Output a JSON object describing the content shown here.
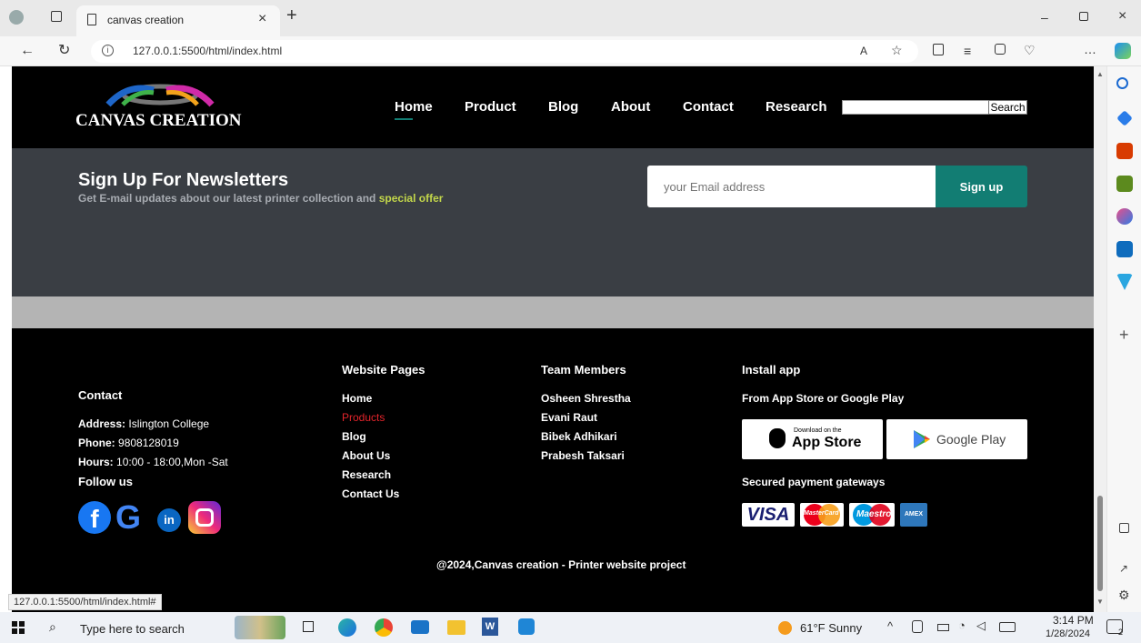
{
  "browser": {
    "tab_title": "canvas creation",
    "url": "127.0.0.1:5500/html/index.html",
    "status_url": "127.0.0.1:5500/html/index.html#"
  },
  "header": {
    "logo_text": "CANVAS CREATION",
    "nav": [
      "Home",
      "Product",
      "Blog",
      "About",
      "Contact",
      "Research"
    ],
    "active_nav": "Home",
    "search_button": "Search",
    "search_value": ""
  },
  "newsletter": {
    "title": "Sign Up For Newsletters",
    "subtitle": "Get E-mail updates about our latest printer collection and",
    "highlight": "special offer",
    "email_placeholder": "your Email address",
    "signup_label": "Sign up"
  },
  "footer": {
    "contact": {
      "heading": "Contact",
      "address_label": "Address:",
      "address": "Islington College",
      "phone_label": "Phone:",
      "phone": "9808128019",
      "hours_label": "Hours:",
      "hours": "10:00 - 18:00,Mon -Sat",
      "follow": "Follow us"
    },
    "pages": {
      "heading": "Website Pages",
      "items": [
        "Home",
        "Products",
        "Blog",
        "About Us",
        "Research",
        "Contact Us"
      ]
    },
    "team": {
      "heading": "Team Members",
      "items": [
        "Osheen Shrestha",
        "Evani Raut",
        "Bibek Adhikari",
        "Prabesh Taksari"
      ]
    },
    "app": {
      "heading": "Install app",
      "sub": "From App Store or Google Play",
      "appstore_small": "Download on the",
      "appstore_big": "App Store",
      "googleplay": "Google Play",
      "secured": "Secured payment gateways",
      "payments": [
        "VISA",
        "MasterCard",
        "Maestro",
        "AMEX"
      ]
    },
    "copyright": "@2024,Canvas creation - Printer website project"
  },
  "taskbar": {
    "search_placeholder": "Type here to search",
    "weather": "61°F Sunny",
    "time": "3:14 PM",
    "date": "1/28/2024",
    "notif_count": "2"
  },
  "colors": {
    "accent_teal": "#127d73",
    "highlight_yellow": "#c2d64a",
    "active_red": "#e3242b"
  }
}
